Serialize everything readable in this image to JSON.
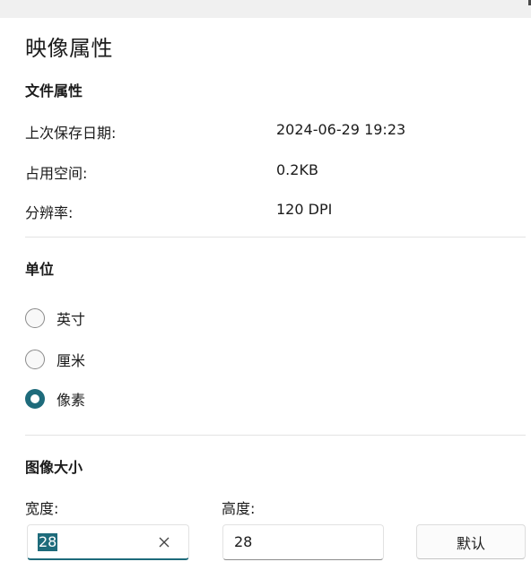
{
  "dialog": {
    "title": "映像属性"
  },
  "file_properties": {
    "section_title": "文件属性",
    "rows": [
      {
        "label": "上次保存日期:",
        "value": "2024-06-29 19:23"
      },
      {
        "label": "占用空间:",
        "value": "0.2KB"
      },
      {
        "label": "分辨率:",
        "value": "120 DPI"
      }
    ]
  },
  "units": {
    "section_title": "单位",
    "options": [
      {
        "label": "英寸",
        "checked": false
      },
      {
        "label": "厘米",
        "checked": false
      },
      {
        "label": "像素",
        "checked": true
      }
    ],
    "accent_color": "#1e6b7b"
  },
  "image_size": {
    "section_title": "图像大小",
    "width_label": "宽度:",
    "width_value": "28",
    "height_label": "高度:",
    "height_value": "28",
    "default_button": "默认"
  }
}
